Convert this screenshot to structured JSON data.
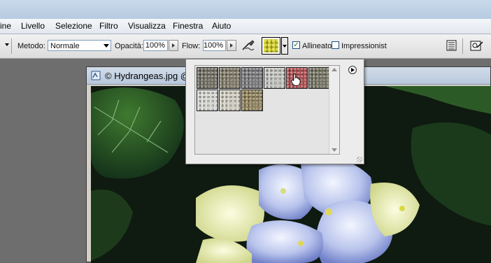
{
  "menubar": {
    "items": [
      "ine",
      "Livello",
      "Selezione",
      "Filtro",
      "Visualizza",
      "Finestra",
      "Aiuto"
    ]
  },
  "options": {
    "method_label": "Metodo:",
    "method_value": "Normale",
    "opacity_label": "Opacità:",
    "opacity_value": "100%",
    "flow_label": "Flow:",
    "flow_value": "100%",
    "aligned_label": "Allineato",
    "aligned_checked": true,
    "impressionist_label": "Impressionist",
    "impressionist_checked": false
  },
  "document": {
    "title": "© Hydrangeas.jpg @"
  },
  "pattern_picker": {
    "patterns": [
      {
        "name": "pattern-1",
        "color": "#6d6a5e"
      },
      {
        "name": "pattern-2",
        "color": "#7d7664"
      },
      {
        "name": "pattern-3",
        "color": "#76767a"
      },
      {
        "name": "pattern-4",
        "color": "#c4c4c0"
      },
      {
        "name": "pattern-5",
        "color": "#b0484a"
      },
      {
        "name": "pattern-6",
        "color": "#71705d"
      },
      {
        "name": "pattern-7",
        "color": "#d8d8d4"
      },
      {
        "name": "pattern-8",
        "color": "#d2d0c2"
      },
      {
        "name": "pattern-9",
        "color": "#8d7f55"
      }
    ],
    "selected_color": "#c3c02a"
  },
  "colors": {
    "accent_check": "#1d6e1d"
  }
}
